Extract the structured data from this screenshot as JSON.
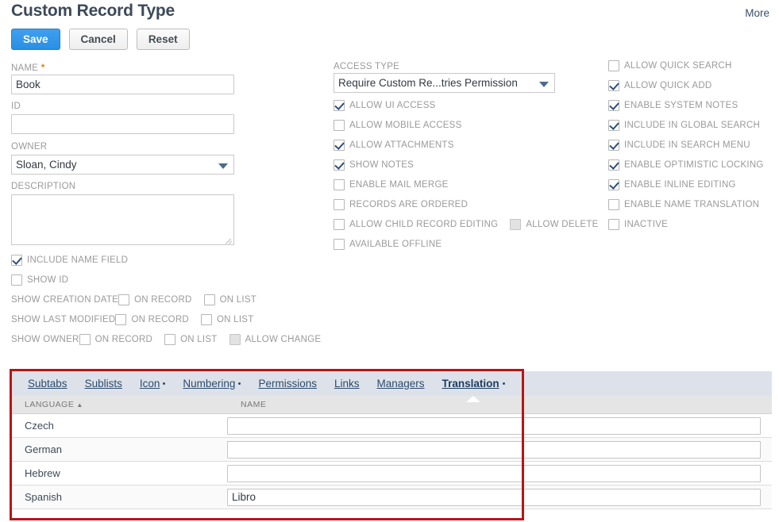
{
  "header": {
    "title": "Custom Record Type",
    "more_label": "More"
  },
  "toolbar": {
    "save_label": "Save",
    "cancel_label": "Cancel",
    "reset_label": "Reset"
  },
  "left_column": {
    "name_label": "NAME",
    "name_required_mark": "*",
    "name_value": "Book",
    "id_label": "ID",
    "id_value": "",
    "owner_label": "OWNER",
    "owner_value": "Sloan, Cindy",
    "description_label": "DESCRIPTION",
    "description_value": "",
    "checkboxes": [
      {
        "label": "INCLUDE NAME FIELD",
        "checked": true,
        "disabled": false
      },
      {
        "label": "SHOW ID",
        "checked": false,
        "disabled": false
      }
    ],
    "inline_rows": [
      {
        "prefix": "SHOW CREATION DATE",
        "options": [
          {
            "label": "ON RECORD",
            "checked": false,
            "disabled": false
          },
          {
            "label": "ON LIST",
            "checked": false,
            "disabled": false
          }
        ]
      },
      {
        "prefix": "SHOW LAST MODIFIED",
        "options": [
          {
            "label": "ON RECORD",
            "checked": false,
            "disabled": false
          },
          {
            "label": "ON LIST",
            "checked": false,
            "disabled": false
          }
        ]
      },
      {
        "prefix": "SHOW OWNER",
        "options": [
          {
            "label": "ON RECORD",
            "checked": false,
            "disabled": false
          },
          {
            "label": "ON LIST",
            "checked": false,
            "disabled": false
          },
          {
            "label": "ALLOW CHANGE",
            "checked": false,
            "disabled": true
          }
        ]
      }
    ]
  },
  "middle_column": {
    "access_type_label": "ACCESS TYPE",
    "access_type_value": "Require Custom Re...tries Permission",
    "checkboxes": [
      {
        "label": "ALLOW UI ACCESS",
        "checked": true,
        "disabled": false
      },
      {
        "label": "ALLOW MOBILE ACCESS",
        "checked": false,
        "disabled": false
      },
      {
        "label": "ALLOW ATTACHMENTS",
        "checked": true,
        "disabled": false
      },
      {
        "label": "SHOW NOTES",
        "checked": true,
        "disabled": false
      },
      {
        "label": "ENABLE MAIL MERGE",
        "checked": false,
        "disabled": false
      },
      {
        "label": "RECORDS ARE ORDERED",
        "checked": false,
        "disabled": false
      },
      {
        "label": "ALLOW CHILD RECORD EDITING",
        "checked": false,
        "disabled": false
      },
      {
        "label": "AVAILABLE OFFLINE",
        "checked": false,
        "disabled": false
      }
    ],
    "allow_delete": {
      "label": "ALLOW DELETE",
      "checked": false,
      "disabled": true
    }
  },
  "right_column": {
    "checkboxes": [
      {
        "label": "ALLOW QUICK SEARCH",
        "checked": false,
        "disabled": false
      },
      {
        "label": "ALLOW QUICK ADD",
        "checked": true,
        "disabled": false
      },
      {
        "label": "ENABLE SYSTEM NOTES",
        "checked": true,
        "disabled": false
      },
      {
        "label": "INCLUDE IN GLOBAL SEARCH",
        "checked": true,
        "disabled": false
      },
      {
        "label": "INCLUDE IN SEARCH MENU",
        "checked": true,
        "disabled": false
      },
      {
        "label": "ENABLE OPTIMISTIC LOCKING",
        "checked": true,
        "disabled": false
      },
      {
        "label": "ENABLE INLINE EDITING",
        "checked": true,
        "disabled": false
      },
      {
        "label": "ENABLE NAME TRANSLATION",
        "checked": false,
        "disabled": false
      },
      {
        "label": "INACTIVE",
        "checked": false,
        "disabled": false
      }
    ]
  },
  "sublist": {
    "tabs": [
      {
        "label": "Subtabs",
        "accesskey_index": 1,
        "has_dot": false,
        "active": false
      },
      {
        "label": "Sublists",
        "accesskey_index": 1,
        "has_dot": false,
        "active": false
      },
      {
        "label": "Icon",
        "accesskey_index": 0,
        "has_dot": true,
        "active": false
      },
      {
        "label": "Numbering",
        "accesskey_index": 0,
        "has_dot": true,
        "active": false
      },
      {
        "label": "Permissions",
        "accesskey_index": 0,
        "has_dot": false,
        "active": false
      },
      {
        "label": "Links",
        "accesskey_index": 0,
        "has_dot": false,
        "active": false
      },
      {
        "label": "Managers",
        "accesskey_index": 0,
        "has_dot": false,
        "active": false
      },
      {
        "label": "Translation",
        "accesskey_index": 0,
        "has_dot": true,
        "active": true
      }
    ],
    "columns": [
      "LANGUAGE",
      "NAME"
    ],
    "sort_indicator": "▲",
    "sort_column": "LANGUAGE",
    "rows": [
      {
        "language": "Czech",
        "name": ""
      },
      {
        "language": "German",
        "name": ""
      },
      {
        "language": "Hebrew",
        "name": ""
      },
      {
        "language": "Spanish",
        "name": "Libro"
      }
    ]
  },
  "annotation": {
    "color": "#b81515"
  }
}
